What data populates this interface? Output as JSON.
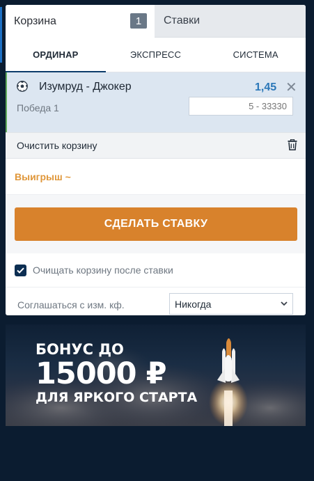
{
  "tabs": {
    "basket_label": "Корзина",
    "basket_count": "1",
    "bets_label": "Ставки"
  },
  "bet_types": [
    "ОРДИНАР",
    "ЭКСПРЕСС",
    "СИСТЕМА"
  ],
  "bet": {
    "match": "Изумруд - Джокер",
    "odds": "1,45",
    "outcome": "Победа 1",
    "stake_placeholder": "5 - 33330",
    "remove_symbol": "✕"
  },
  "clear_basket_label": "Очистить корзину",
  "win_label": "Выигрыш  ~",
  "place_bet_label": "СДЕЛАТЬ СТАВКУ",
  "clear_after_bet": {
    "label": "Очищать корзину после ставки",
    "checked": true
  },
  "agree_odds": {
    "label": "Соглашаться с изм. кф.",
    "selected": "Никогда"
  },
  "banner": {
    "line1": "БОНУС ДО",
    "line2": "15000 ₽",
    "line3": "ДЛЯ ЯРКОГО СТАРТА"
  },
  "colors": {
    "accent": "#d8822c",
    "odds": "#2a77b8",
    "win": "#e0973a",
    "page_bg": "#0b1c30"
  }
}
